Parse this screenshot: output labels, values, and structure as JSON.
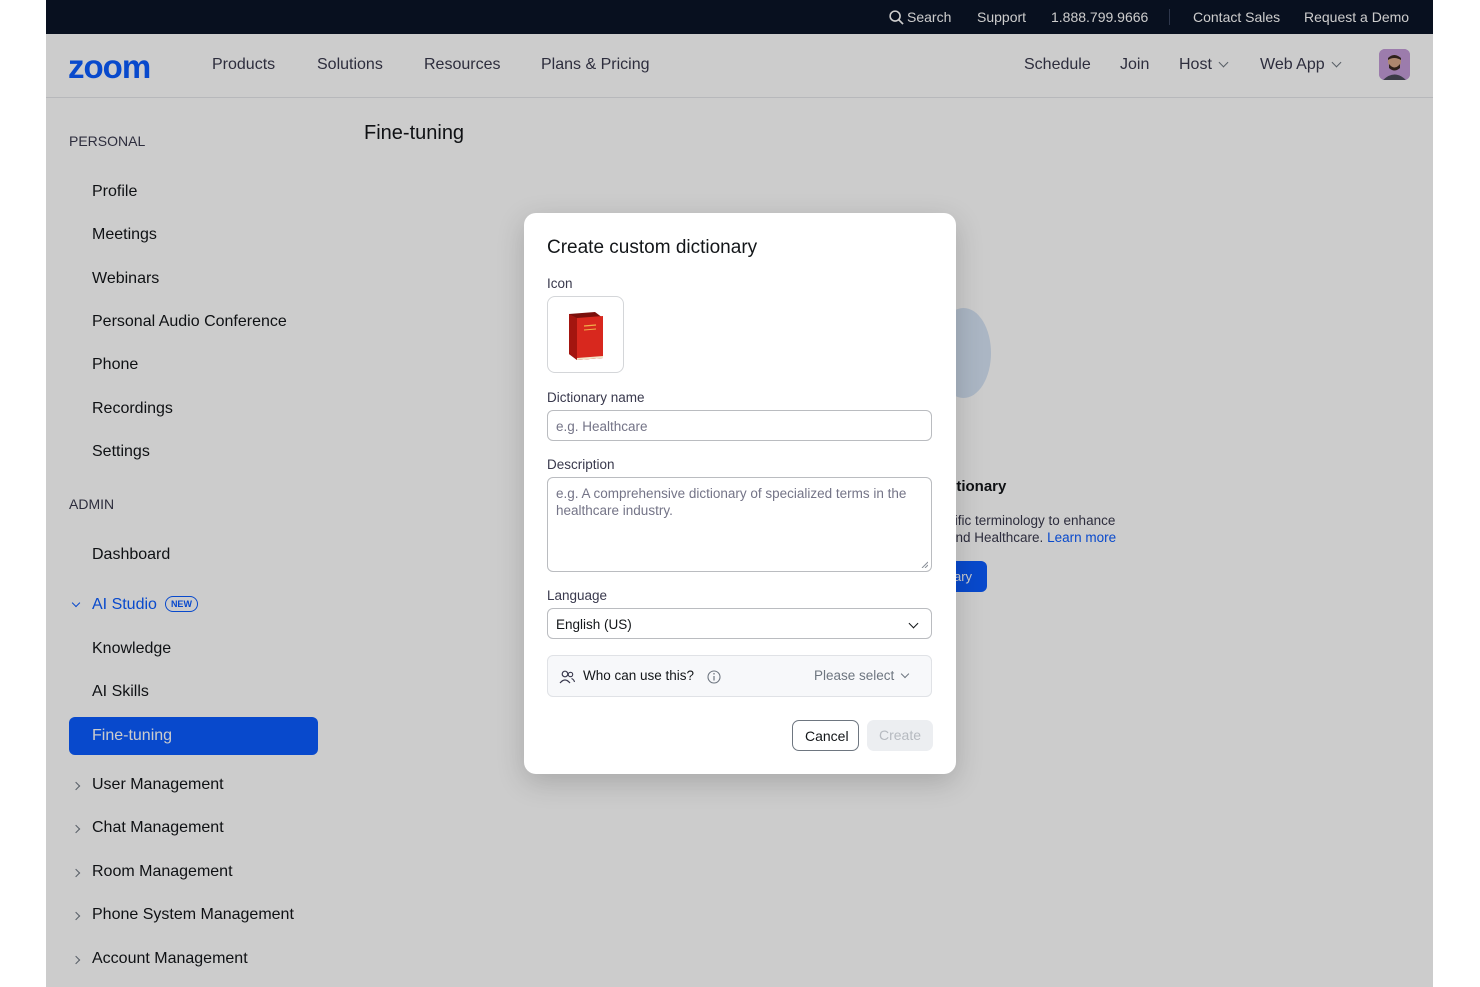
{
  "utility_bar": {
    "search": "Search",
    "support": "Support",
    "phone": "1.888.799.9666",
    "contact_sales": "Contact Sales",
    "request_demo": "Request a Demo"
  },
  "nav": {
    "logo": "zoom",
    "products": "Products",
    "solutions": "Solutions",
    "resources": "Resources",
    "plans": "Plans & Pricing",
    "schedule": "Schedule",
    "join": "Join",
    "host": "Host",
    "web_app": "Web App"
  },
  "sidebar": {
    "personal_heading": "PERSONAL",
    "personal_items": [
      "Profile",
      "Meetings",
      "Webinars",
      "Personal Audio Conference",
      "Phone",
      "Recordings",
      "Settings"
    ],
    "admin_heading": "ADMIN",
    "dashboard": "Dashboard",
    "ai_studio": "AI Studio",
    "ai_studio_badge": "NEW",
    "ai_studio_items": [
      "Knowledge",
      "AI Skills"
    ],
    "active_item": "Fine-tuning",
    "admin_collapsed": [
      "User Management",
      "Chat Management",
      "Room Management",
      "Phone System Management",
      "Account Management"
    ]
  },
  "content": {
    "page_title": "Fine-tuning",
    "bg_heading": "ctionary",
    "bg_desc_line1": "cific terminology to enhance",
    "bg_desc_line2": "and Healthcare.",
    "bg_learn_more": "Learn more",
    "bg_button": "ary"
  },
  "modal": {
    "title": "Create custom dictionary",
    "icon_label": "Icon",
    "name_label": "Dictionary name",
    "name_placeholder": "e.g. Healthcare",
    "desc_label": "Description",
    "desc_placeholder": "e.g. A comprehensive dictionary of specialized terms in the healthcare industry.",
    "language_label": "Language",
    "language_value": "English (US)",
    "who_label": "Who can use this?",
    "who_select": "Please select",
    "cancel": "Cancel",
    "create": "Create"
  },
  "colors": {
    "brand": "#0b5cff",
    "top_bar": "#0b1427",
    "book": "#d8281e"
  }
}
